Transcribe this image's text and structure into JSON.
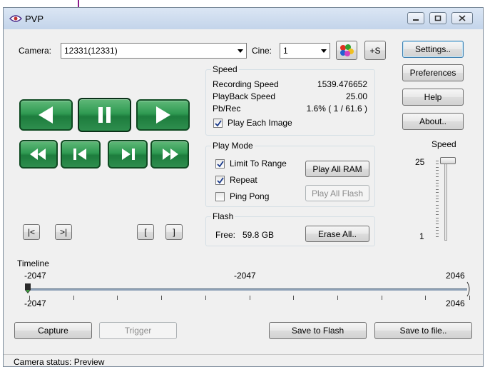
{
  "window": {
    "title": "PVP"
  },
  "camera": {
    "label": "Camera:",
    "value": "12331(12331)"
  },
  "cine": {
    "label": "Cine:",
    "value": "1"
  },
  "add_cine_label": "+S",
  "side_buttons": {
    "settings": "Settings..",
    "preferences": "Preferences",
    "help": "Help",
    "about": "About.."
  },
  "speed_group": {
    "title": "Speed",
    "recording_label": "Recording Speed",
    "recording_value": "1539.476652",
    "playback_label": "PlayBack Speed",
    "playback_value": "25.00",
    "pbrec_label": "Pb/Rec",
    "pbrec_value": "1.6% ( 1 / 61.6 )",
    "play_each_label": "Play Each Image",
    "play_each_checked": true
  },
  "playmode_group": {
    "title": "Play Mode",
    "limit_label": "Limit To Range",
    "limit_checked": true,
    "repeat_label": "Repeat",
    "repeat_checked": true,
    "pingpong_label": "Ping Pong",
    "pingpong_checked": false,
    "play_all_ram": "Play All RAM",
    "play_all_flash": "Play All Flash"
  },
  "flash_group": {
    "title": "Flash",
    "free_label": "Free:",
    "free_value": "59.8 GB",
    "erase": "Erase All.."
  },
  "speed_slider": {
    "title": "Speed",
    "max_label": "25",
    "min_label": "1",
    "value": 25
  },
  "nav_buttons": {
    "first": "|<",
    "last": ">|",
    "mark_in": "[",
    "mark_out": "]"
  },
  "timeline": {
    "label": "Timeline",
    "top_left": "-2047",
    "top_mid": "-2047",
    "top_right": "2046",
    "bottom_left": "-2047",
    "bottom_right": "2046",
    "min": -2047,
    "max": 2046,
    "position": -2047
  },
  "bottom_buttons": {
    "capture": "Capture",
    "trigger": "Trigger",
    "save_flash": "Save to Flash",
    "save_file": "Save to file.."
  },
  "status": {
    "text": "Camera status: Preview"
  },
  "colors": {
    "play_green": "#2f9a52",
    "accent_blue": "#3c7fb1"
  }
}
